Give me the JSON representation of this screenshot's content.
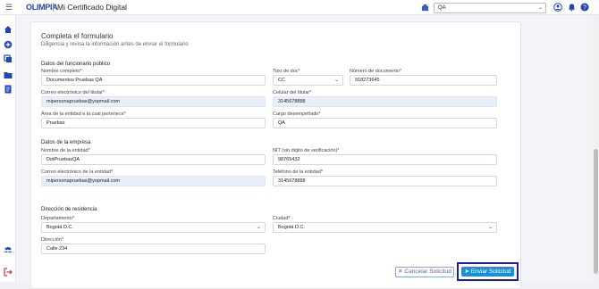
{
  "header": {
    "logo": "OLIMPIA",
    "app_title": "Mi Certificado Digital",
    "env_select_value": "QA"
  },
  "form": {
    "title": "Completa el formulario",
    "subtitle": "Diligencia y revisa la información antes de enviar el formulario",
    "official": {
      "section": "Datos del funcionario público",
      "name_label": "Nombre completo*",
      "name_value": "Documentos Pruebas QA",
      "doc_type_label": "Tipo de doc*",
      "doc_type_value": "CC",
      "doc_number_label": "Número de documento*",
      "doc_number_value": "918273645",
      "email_label": "Correo electrónico del titular*",
      "email_value": "mipersonapruebas@yopmail.com",
      "phone_label": "Celular del titular*",
      "phone_value": "3145678888",
      "area_label": "Área de la entidad a la cual pertenece*",
      "area_value": "Pruebas",
      "role_label": "Cargo desempeñado*",
      "role_value": "QA"
    },
    "company": {
      "section": "Datos de la empresa",
      "name_label": "Nombre de la entidad*",
      "name_value": "DotPruebasQA",
      "nit_label": "NIT (sin digito de verificación)*",
      "nit_value": "98765432",
      "email_label": "Correo electrónico de la entidad*",
      "email_value": "mipersonapruebas@yopmail.com",
      "phone_label": "Teléfono de la entidad*",
      "phone_value": "3145678888"
    },
    "address": {
      "section": "Dirección de residencia",
      "department_label": "Departamento*",
      "department_value": "Bogotá D.C.",
      "city_label": "Ciudad*",
      "city_value": "Bogotá D.C.",
      "address_label": "Dirección*",
      "address_value": "Calle 234"
    },
    "buttons": {
      "cancel": "✕ Cancelar Solicitud",
      "send": "➤ Enviar Solicitud"
    }
  },
  "colors": {
    "brand": "#1f46b3",
    "primary_button": "#1b8fd6",
    "readonly_field": "#e9eefb"
  }
}
